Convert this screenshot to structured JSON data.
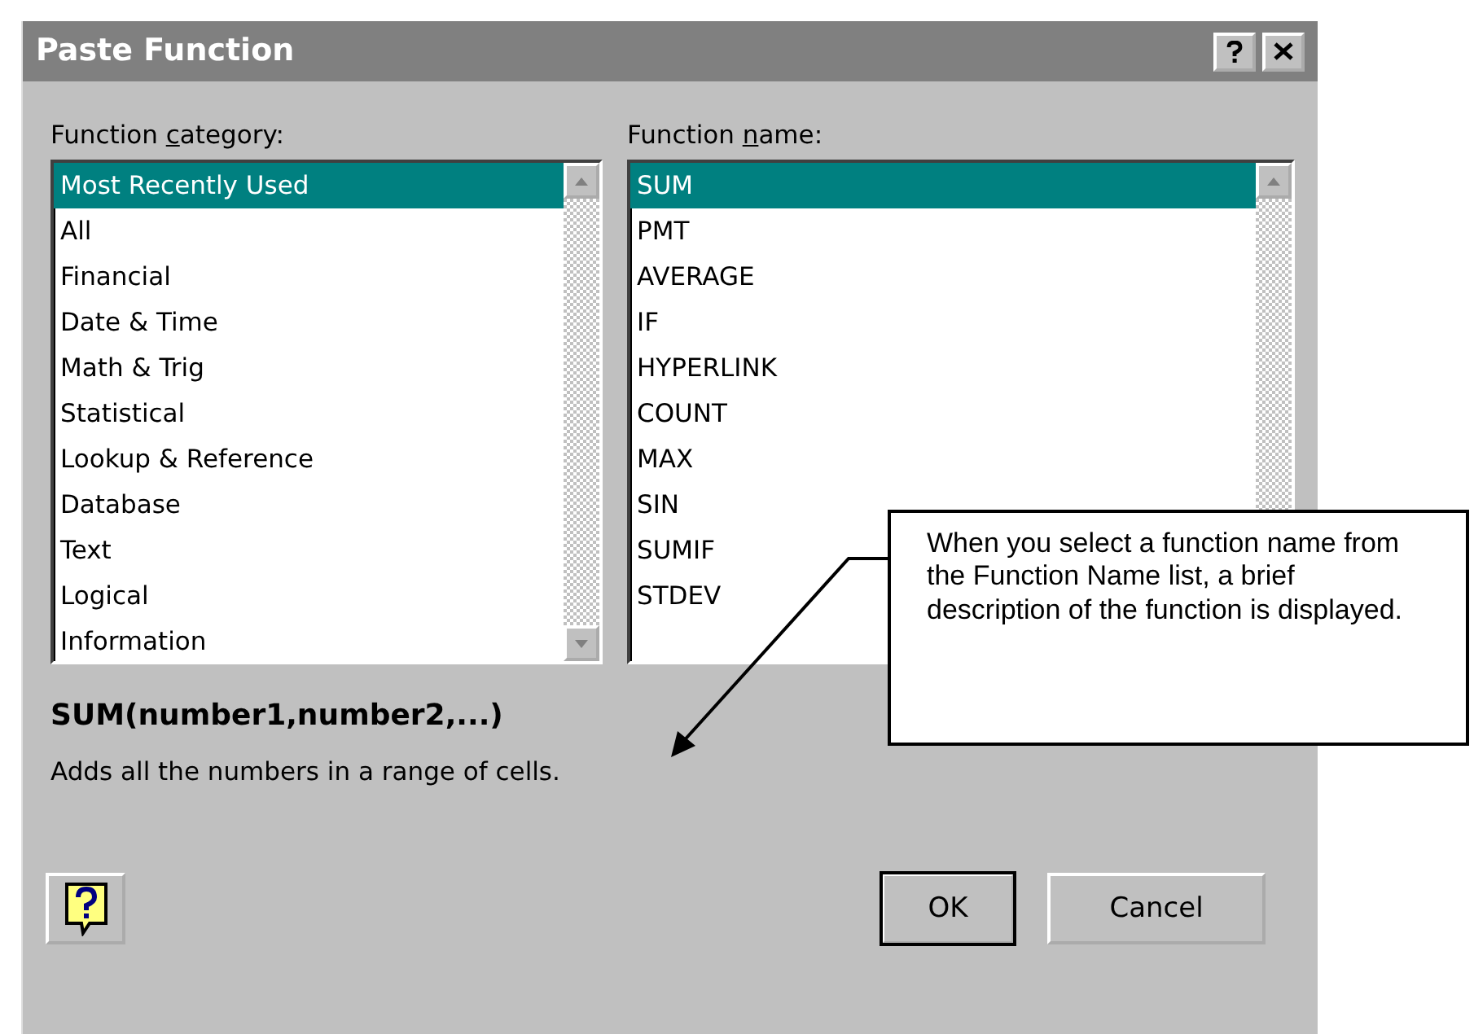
{
  "window": {
    "title": "Paste Function"
  },
  "category_list": {
    "label": {
      "before": "Function ",
      "key": "c",
      "after": "ategory:"
    },
    "items": [
      {
        "label": "Most Recently Used",
        "selected": true
      },
      {
        "label": "All",
        "selected": false
      },
      {
        "label": "Financial",
        "selected": false
      },
      {
        "label": "Date & Time",
        "selected": false
      },
      {
        "label": "Math & Trig",
        "selected": false
      },
      {
        "label": "Statistical",
        "selected": false
      },
      {
        "label": "Lookup & Reference",
        "selected": false
      },
      {
        "label": "Database",
        "selected": false
      },
      {
        "label": "Text",
        "selected": false
      },
      {
        "label": "Logical",
        "selected": false
      },
      {
        "label": "Information",
        "selected": false
      }
    ]
  },
  "name_list": {
    "label": {
      "before": "Function ",
      "key": "n",
      "after": "ame:"
    },
    "items": [
      {
        "label": "SUM",
        "selected": true
      },
      {
        "label": "PMT",
        "selected": false
      },
      {
        "label": "AVERAGE",
        "selected": false
      },
      {
        "label": "IF",
        "selected": false
      },
      {
        "label": "HYPERLINK",
        "selected": false
      },
      {
        "label": "COUNT",
        "selected": false
      },
      {
        "label": "MAX",
        "selected": false
      },
      {
        "label": "SIN",
        "selected": false
      },
      {
        "label": "SUMIF",
        "selected": false
      },
      {
        "label": "STDEV",
        "selected": false
      }
    ]
  },
  "signature": "SUM(number1,number2,...)",
  "description": "Adds all the numbers in a range of cells.",
  "buttons": [
    {
      "label": "OK",
      "default": true
    },
    {
      "label": "Cancel",
      "default": false
    }
  ],
  "callout": {
    "text": "When you select a function name from the Function Name list, a brief description of the function is displayed."
  }
}
